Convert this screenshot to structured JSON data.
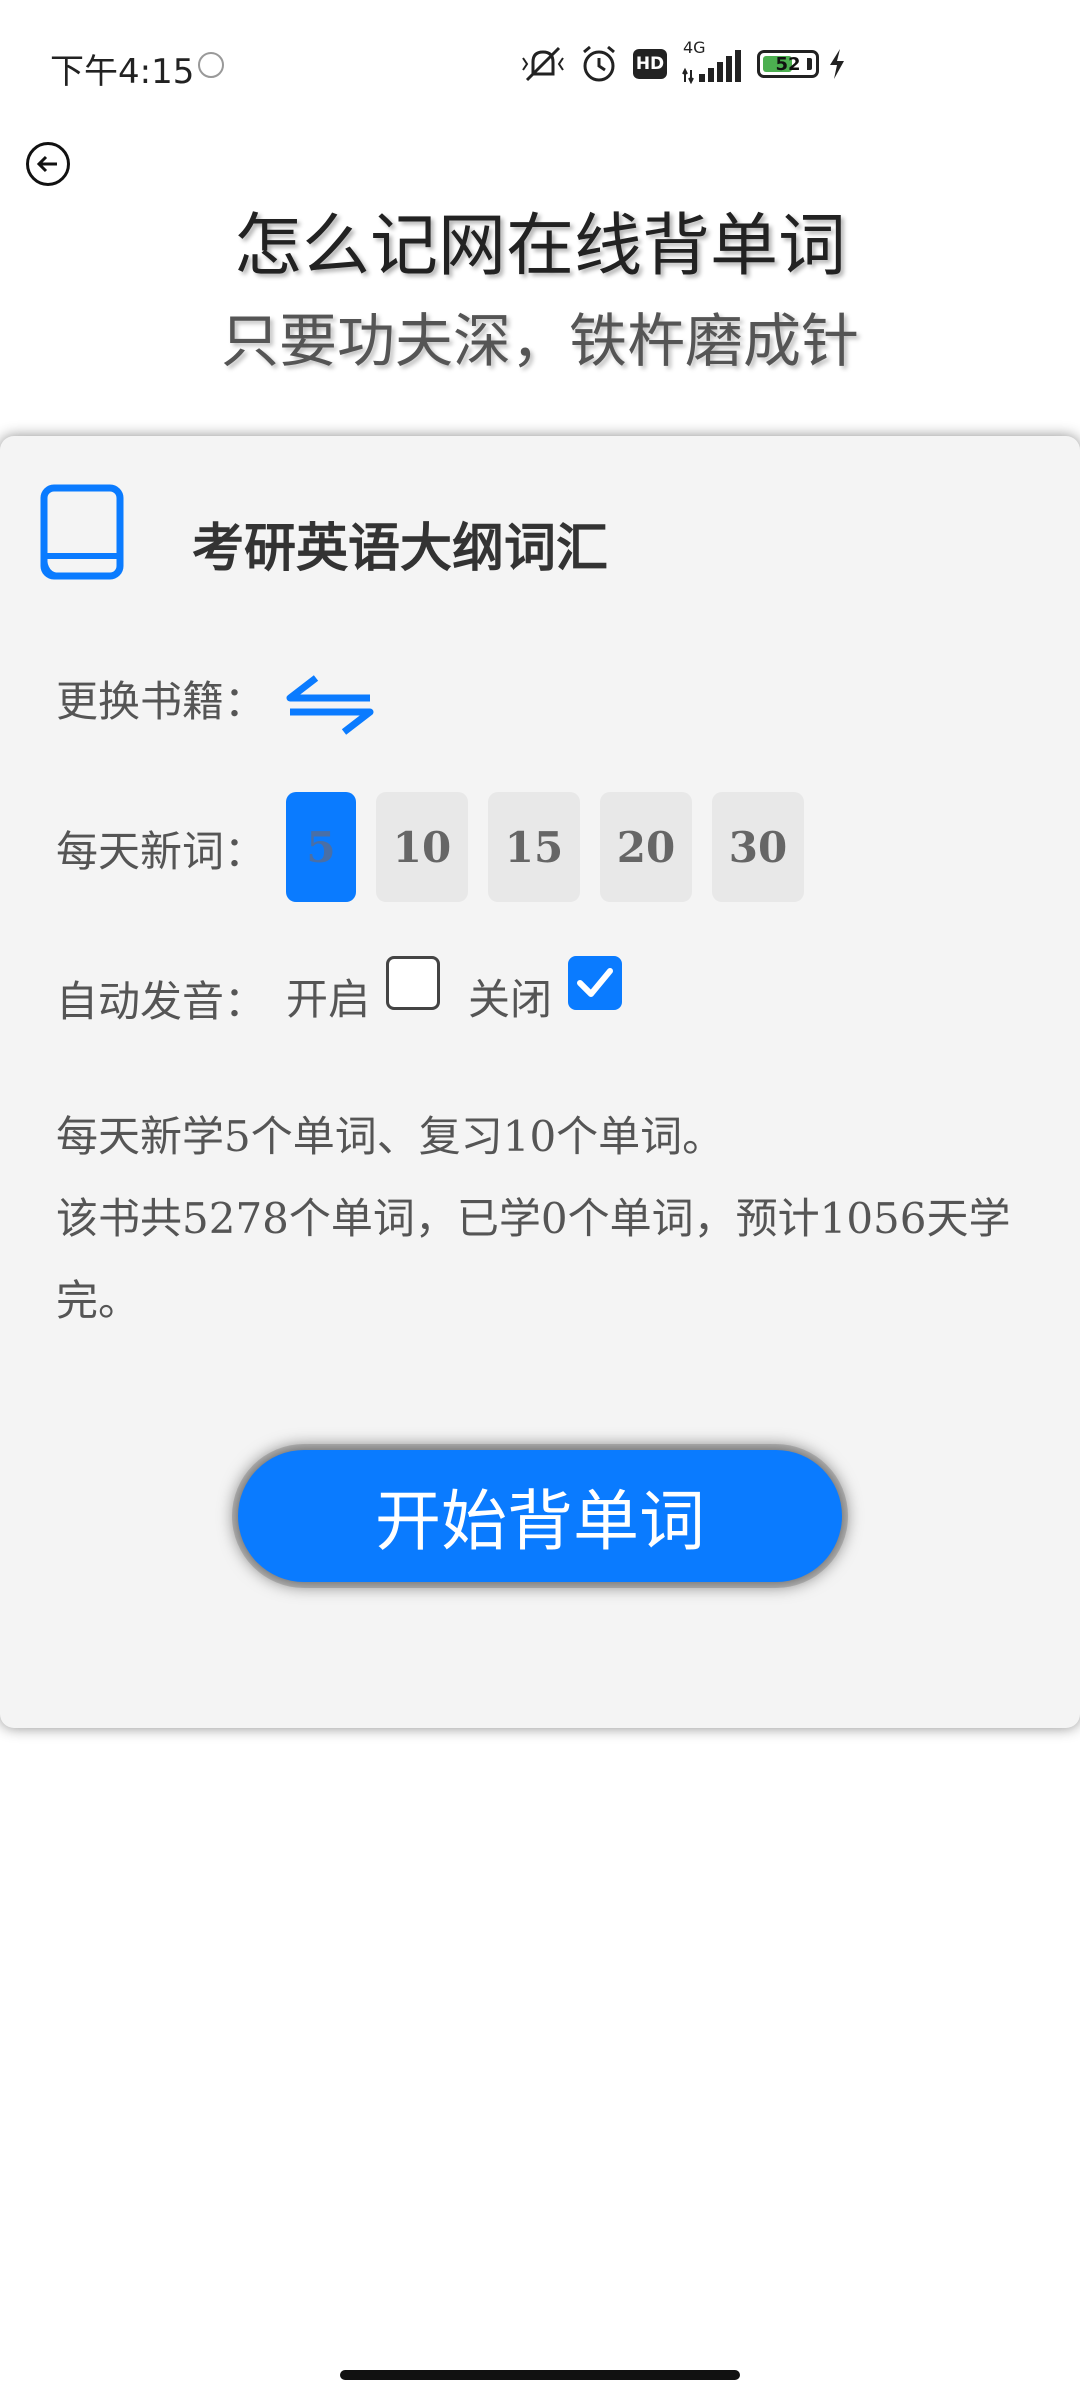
{
  "status_bar": {
    "time": "下午4:15",
    "network": "4G",
    "hd": "HD",
    "battery": "52",
    "battery_level": 0.52
  },
  "header": {
    "title": "怎么记网在线背单词",
    "subtitle": "只要功夫深，铁杵磨成针"
  },
  "book": {
    "name": "考研英语大纲词汇",
    "change_label": "更换书籍："
  },
  "daily": {
    "label": "每天新词：",
    "options": [
      "5",
      "10",
      "15",
      "20",
      "30"
    ],
    "selected": "5"
  },
  "sound": {
    "label": "自动发音：",
    "on_label": "开启",
    "off_label": "关闭",
    "on_checked": false,
    "off_checked": true
  },
  "info": {
    "line1": "每天新学5个单词、复习10个单词。",
    "line2": "该书共5278个单词，已学0个单词，预计1056天学完。"
  },
  "start_button": "开始背单词",
  "colors": {
    "accent": "#0a7bff",
    "card_bg": "#f4f4f4"
  }
}
